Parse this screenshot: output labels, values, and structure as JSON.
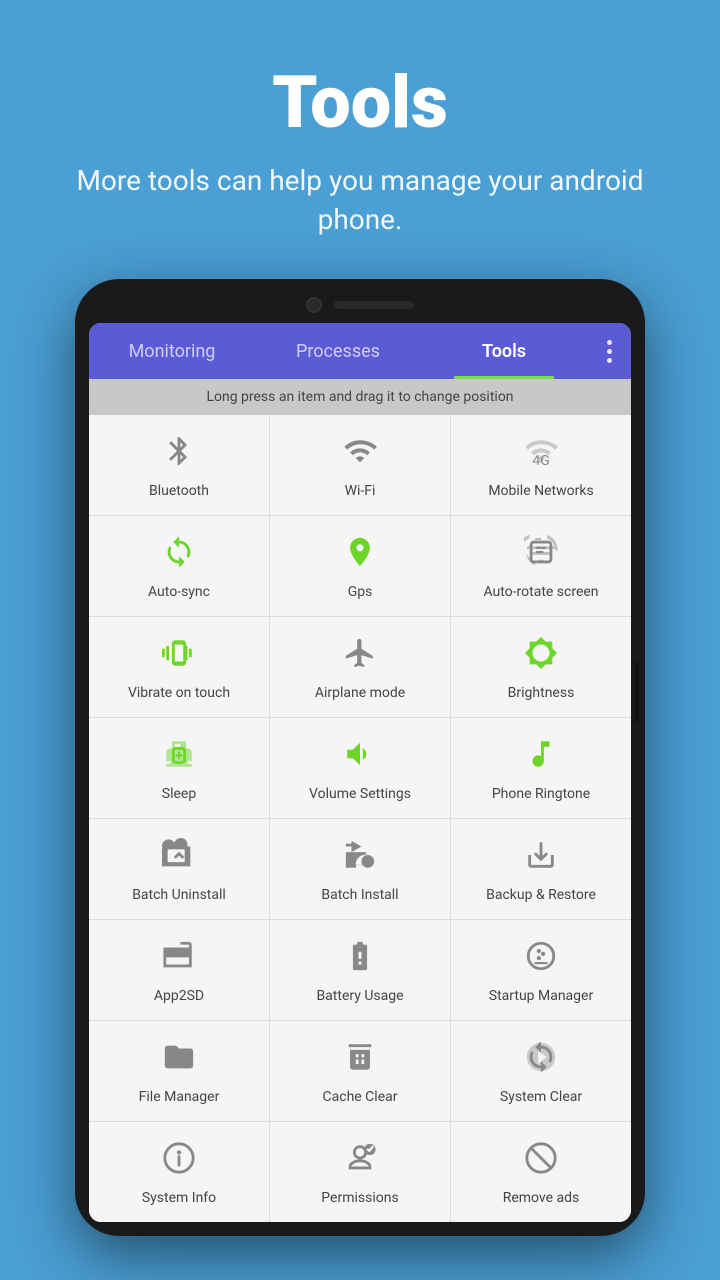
{
  "header": {
    "title": "Tools",
    "subtitle": "More tools can help you manage your android phone."
  },
  "tabs": {
    "items": [
      {
        "label": "Monitoring",
        "active": false
      },
      {
        "label": "Processes",
        "active": false
      },
      {
        "label": "Tools",
        "active": true
      }
    ],
    "menu_icon": "⋮"
  },
  "hint": {
    "text": "Long press an item and drag it to change position"
  },
  "tools": [
    {
      "label": "Bluetooth",
      "icon": "bluetooth",
      "color": "gray"
    },
    {
      "label": "Wi-Fi",
      "icon": "wifi",
      "color": "gray"
    },
    {
      "label": "Mobile Networks",
      "icon": "mobile_net",
      "color": "gray"
    },
    {
      "label": "Auto-sync",
      "icon": "autosync",
      "color": "green"
    },
    {
      "label": "Gps",
      "icon": "gps",
      "color": "green"
    },
    {
      "label": "Auto-rotate screen",
      "icon": "autorotate",
      "color": "gray"
    },
    {
      "label": "Vibrate on touch",
      "icon": "vibrate",
      "color": "green"
    },
    {
      "label": "Airplane mode",
      "icon": "airplane",
      "color": "gray"
    },
    {
      "label": "Brightness",
      "icon": "brightness",
      "color": "green"
    },
    {
      "label": "Sleep",
      "icon": "sleep",
      "color": "green"
    },
    {
      "label": "Volume Settings",
      "icon": "volume",
      "color": "green"
    },
    {
      "label": "Phone Ringtone",
      "icon": "ringtone",
      "color": "green"
    },
    {
      "label": "Batch Uninstall",
      "icon": "batch_uninstall",
      "color": "gray"
    },
    {
      "label": "Batch Install",
      "icon": "batch_install",
      "color": "gray"
    },
    {
      "label": "Backup & Restore",
      "icon": "backup",
      "color": "gray"
    },
    {
      "label": "App2SD",
      "icon": "app2sd",
      "color": "gray"
    },
    {
      "label": "Battery Usage",
      "icon": "battery",
      "color": "gray"
    },
    {
      "label": "Startup Manager",
      "icon": "startup",
      "color": "gray"
    },
    {
      "label": "File Manager",
      "icon": "file",
      "color": "gray"
    },
    {
      "label": "Cache Clear",
      "icon": "cache",
      "color": "gray"
    },
    {
      "label": "System Clear",
      "icon": "sysclear",
      "color": "gray"
    },
    {
      "label": "System Info",
      "icon": "sysinfo",
      "color": "gray"
    },
    {
      "label": "Permissions",
      "icon": "permissions",
      "color": "gray"
    },
    {
      "label": "Remove ads",
      "icon": "removeads",
      "color": "gray"
    }
  ]
}
